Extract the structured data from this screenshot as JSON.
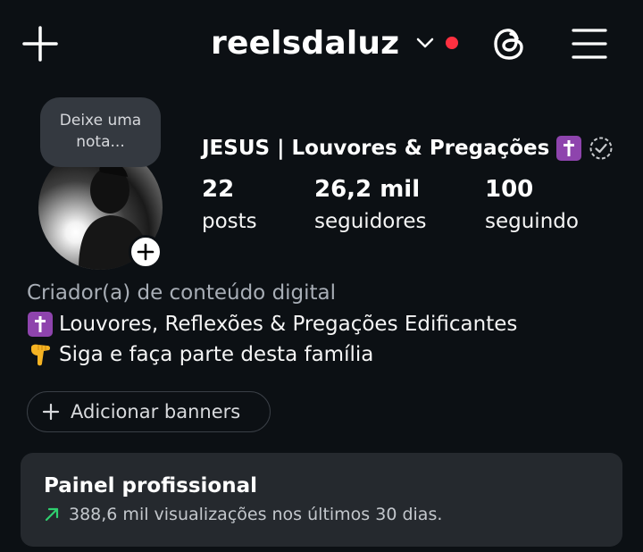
{
  "header": {
    "username": "reelsdaluz",
    "icons": {
      "add": "plus-icon",
      "dropdown": "chevron-down-icon",
      "notification_dot_color": "#ff3040",
      "threads": "threads-icon",
      "menu": "hamburger-menu-icon"
    }
  },
  "profile": {
    "note_placeholder_line1": "Deixe uma",
    "note_placeholder_line2": "nota...",
    "display_name": "JESUS | Louvores & Pregações",
    "display_name_badge": "✝️",
    "stats": [
      {
        "value": "22",
        "label": "posts"
      },
      {
        "value": "26,2 mil",
        "label": "seguidores"
      },
      {
        "value": "100",
        "label": "seguindo"
      }
    ],
    "category": "Criador(a) de conteúdo digital",
    "bio": [
      {
        "emoji": "✝️",
        "text": "Louvores, Reflexões & Pregações Edificantes"
      },
      {
        "emoji": "👇",
        "text": "Siga e faça parte desta família"
      }
    ],
    "add_banners_label": "Adicionar banners"
  },
  "professional_dashboard": {
    "title": "Painel profissional",
    "subtitle": "388,6 mil visualizações nos últimos 30 dias.",
    "trend_color": "#2fcf6f"
  },
  "colors": {
    "background": "#0c1014",
    "accent_purple": "#8e44ad",
    "card": "#25292e"
  }
}
